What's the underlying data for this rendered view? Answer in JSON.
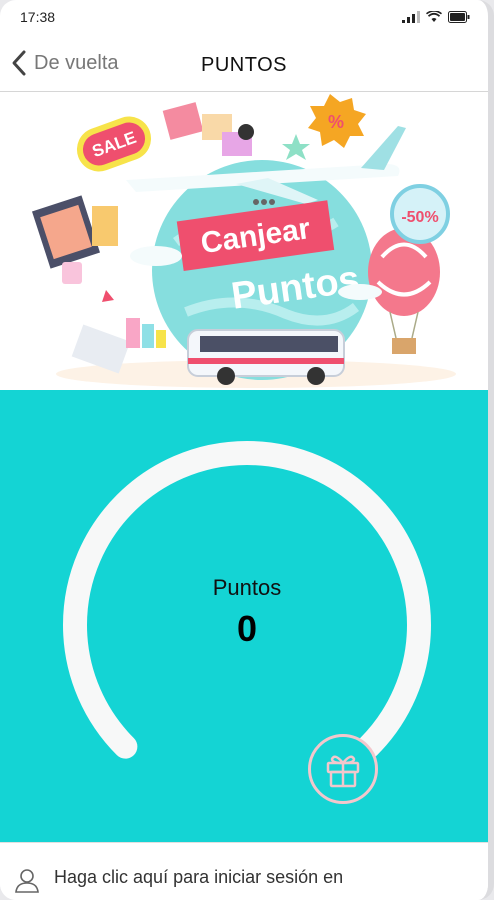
{
  "status_bar": {
    "time": "17:38",
    "icons": [
      "signal-icon",
      "wifi-icon",
      "battery-icon"
    ]
  },
  "nav": {
    "back_label": "De vuelta",
    "title": "PUNTOS"
  },
  "banner": {
    "heading_line1": "Canjear",
    "heading_line2": "Puntos",
    "sale_tag": "SALE",
    "percent_badge": "%",
    "discount_badge": "-50%"
  },
  "points": {
    "label": "Puntos",
    "value": "0",
    "progress": 0
  },
  "login": {
    "text": "Haga clic aquí para iniciar sesión en"
  },
  "colors": {
    "panel": "#14d4d4",
    "gauge_track": "#f7f8f8",
    "gift_ring": "#f3c7cc",
    "banner_pink": "#ef4f6e",
    "banner_teal": "#7fdcdc"
  }
}
